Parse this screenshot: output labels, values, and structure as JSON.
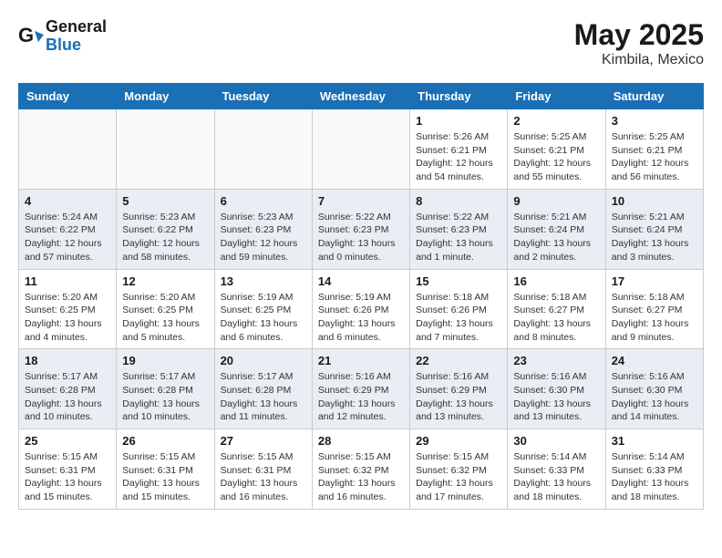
{
  "header": {
    "logo_line1": "General",
    "logo_line2": "Blue",
    "month": "May 2025",
    "location": "Kimbila, Mexico"
  },
  "days_of_week": [
    "Sunday",
    "Monday",
    "Tuesday",
    "Wednesday",
    "Thursday",
    "Friday",
    "Saturday"
  ],
  "weeks": [
    [
      {
        "day": "",
        "info": ""
      },
      {
        "day": "",
        "info": ""
      },
      {
        "day": "",
        "info": ""
      },
      {
        "day": "",
        "info": ""
      },
      {
        "day": "1",
        "info": "Sunrise: 5:26 AM\nSunset: 6:21 PM\nDaylight: 12 hours\nand 54 minutes."
      },
      {
        "day": "2",
        "info": "Sunrise: 5:25 AM\nSunset: 6:21 PM\nDaylight: 12 hours\nand 55 minutes."
      },
      {
        "day": "3",
        "info": "Sunrise: 5:25 AM\nSunset: 6:21 PM\nDaylight: 12 hours\nand 56 minutes."
      }
    ],
    [
      {
        "day": "4",
        "info": "Sunrise: 5:24 AM\nSunset: 6:22 PM\nDaylight: 12 hours\nand 57 minutes."
      },
      {
        "day": "5",
        "info": "Sunrise: 5:23 AM\nSunset: 6:22 PM\nDaylight: 12 hours\nand 58 minutes."
      },
      {
        "day": "6",
        "info": "Sunrise: 5:23 AM\nSunset: 6:23 PM\nDaylight: 12 hours\nand 59 minutes."
      },
      {
        "day": "7",
        "info": "Sunrise: 5:22 AM\nSunset: 6:23 PM\nDaylight: 13 hours\nand 0 minutes."
      },
      {
        "day": "8",
        "info": "Sunrise: 5:22 AM\nSunset: 6:23 PM\nDaylight: 13 hours\nand 1 minute."
      },
      {
        "day": "9",
        "info": "Sunrise: 5:21 AM\nSunset: 6:24 PM\nDaylight: 13 hours\nand 2 minutes."
      },
      {
        "day": "10",
        "info": "Sunrise: 5:21 AM\nSunset: 6:24 PM\nDaylight: 13 hours\nand 3 minutes."
      }
    ],
    [
      {
        "day": "11",
        "info": "Sunrise: 5:20 AM\nSunset: 6:25 PM\nDaylight: 13 hours\nand 4 minutes."
      },
      {
        "day": "12",
        "info": "Sunrise: 5:20 AM\nSunset: 6:25 PM\nDaylight: 13 hours\nand 5 minutes."
      },
      {
        "day": "13",
        "info": "Sunrise: 5:19 AM\nSunset: 6:25 PM\nDaylight: 13 hours\nand 6 minutes."
      },
      {
        "day": "14",
        "info": "Sunrise: 5:19 AM\nSunset: 6:26 PM\nDaylight: 13 hours\nand 6 minutes."
      },
      {
        "day": "15",
        "info": "Sunrise: 5:18 AM\nSunset: 6:26 PM\nDaylight: 13 hours\nand 7 minutes."
      },
      {
        "day": "16",
        "info": "Sunrise: 5:18 AM\nSunset: 6:27 PM\nDaylight: 13 hours\nand 8 minutes."
      },
      {
        "day": "17",
        "info": "Sunrise: 5:18 AM\nSunset: 6:27 PM\nDaylight: 13 hours\nand 9 minutes."
      }
    ],
    [
      {
        "day": "18",
        "info": "Sunrise: 5:17 AM\nSunset: 6:28 PM\nDaylight: 13 hours\nand 10 minutes."
      },
      {
        "day": "19",
        "info": "Sunrise: 5:17 AM\nSunset: 6:28 PM\nDaylight: 13 hours\nand 10 minutes."
      },
      {
        "day": "20",
        "info": "Sunrise: 5:17 AM\nSunset: 6:28 PM\nDaylight: 13 hours\nand 11 minutes."
      },
      {
        "day": "21",
        "info": "Sunrise: 5:16 AM\nSunset: 6:29 PM\nDaylight: 13 hours\nand 12 minutes."
      },
      {
        "day": "22",
        "info": "Sunrise: 5:16 AM\nSunset: 6:29 PM\nDaylight: 13 hours\nand 13 minutes."
      },
      {
        "day": "23",
        "info": "Sunrise: 5:16 AM\nSunset: 6:30 PM\nDaylight: 13 hours\nand 13 minutes."
      },
      {
        "day": "24",
        "info": "Sunrise: 5:16 AM\nSunset: 6:30 PM\nDaylight: 13 hours\nand 14 minutes."
      }
    ],
    [
      {
        "day": "25",
        "info": "Sunrise: 5:15 AM\nSunset: 6:31 PM\nDaylight: 13 hours\nand 15 minutes."
      },
      {
        "day": "26",
        "info": "Sunrise: 5:15 AM\nSunset: 6:31 PM\nDaylight: 13 hours\nand 15 minutes."
      },
      {
        "day": "27",
        "info": "Sunrise: 5:15 AM\nSunset: 6:31 PM\nDaylight: 13 hours\nand 16 minutes."
      },
      {
        "day": "28",
        "info": "Sunrise: 5:15 AM\nSunset: 6:32 PM\nDaylight: 13 hours\nand 16 minutes."
      },
      {
        "day": "29",
        "info": "Sunrise: 5:15 AM\nSunset: 6:32 PM\nDaylight: 13 hours\nand 17 minutes."
      },
      {
        "day": "30",
        "info": "Sunrise: 5:14 AM\nSunset: 6:33 PM\nDaylight: 13 hours\nand 18 minutes."
      },
      {
        "day": "31",
        "info": "Sunrise: 5:14 AM\nSunset: 6:33 PM\nDaylight: 13 hours\nand 18 minutes."
      }
    ]
  ]
}
